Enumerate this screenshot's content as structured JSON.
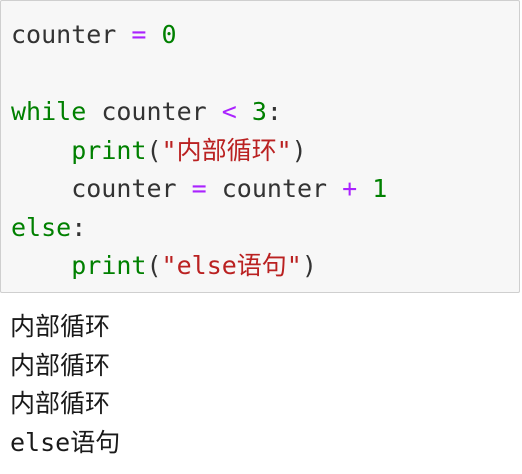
{
  "code_cell": {
    "lines": [
      {
        "tokens": [
          {
            "t": "counter",
            "c": "var"
          },
          {
            "t": " ",
            "c": "var"
          },
          {
            "t": "=",
            "c": "op"
          },
          {
            "t": " ",
            "c": "var"
          },
          {
            "t": "0",
            "c": "num"
          }
        ]
      },
      {
        "tokens": []
      },
      {
        "tokens": [
          {
            "t": "while",
            "c": "kw"
          },
          {
            "t": " counter ",
            "c": "var"
          },
          {
            "t": "<",
            "c": "op"
          },
          {
            "t": " ",
            "c": "var"
          },
          {
            "t": "3",
            "c": "num"
          },
          {
            "t": ":",
            "c": "var"
          }
        ]
      },
      {
        "tokens": [
          {
            "t": "    ",
            "c": "var"
          },
          {
            "t": "print",
            "c": "bi"
          },
          {
            "t": "(",
            "c": "var"
          },
          {
            "t": "\"内部循环\"",
            "c": "str"
          },
          {
            "t": ")",
            "c": "var"
          }
        ]
      },
      {
        "tokens": [
          {
            "t": "    counter ",
            "c": "var"
          },
          {
            "t": "=",
            "c": "op"
          },
          {
            "t": " counter ",
            "c": "var"
          },
          {
            "t": "+",
            "c": "op"
          },
          {
            "t": " ",
            "c": "var"
          },
          {
            "t": "1",
            "c": "num"
          }
        ]
      },
      {
        "tokens": [
          {
            "t": "else",
            "c": "kw"
          },
          {
            "t": ":",
            "c": "var"
          }
        ]
      },
      {
        "tokens": [
          {
            "t": "    ",
            "c": "var"
          },
          {
            "t": "print",
            "c": "bi"
          },
          {
            "t": "(",
            "c": "var"
          },
          {
            "t": "\"else语句\"",
            "c": "str"
          },
          {
            "t": ")",
            "c": "var"
          }
        ]
      }
    ]
  },
  "output_cell": {
    "lines": [
      "内部循环",
      "内部循环",
      "内部循环",
      "else语句"
    ]
  },
  "colors": {
    "keyword": "#008000",
    "operator": "#aa22ff",
    "number": "#008000",
    "builtin": "#008000",
    "string": "#ba2121",
    "text": "#333333",
    "cell_background": "#f7f7f7",
    "cell_border": "#cfcfcf"
  }
}
